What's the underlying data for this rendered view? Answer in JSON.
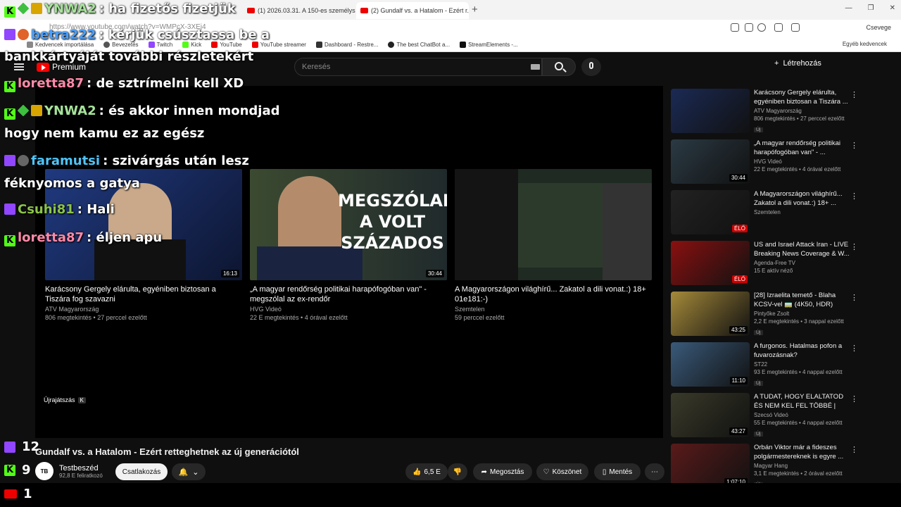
{
  "browser": {
    "tabs": [
      {
        "label": "(1) 2026.03.31. A 150-es személysz..."
      },
      {
        "label": "(2) Gundalf vs. a Hatalom - Ezért r..."
      }
    ],
    "url": "https://www.youtube.com/watch?v=WMPcX-3XEj4",
    "profile_label": "Csevege",
    "bookmarks": [
      "Kedvencek importálása",
      "Bevezetés",
      "Twitch",
      "Kick",
      "YouTube",
      "YouTube streamer",
      "Dashboard - Restre...",
      "The best ChatBot a...",
      "StreamElements -..."
    ],
    "bookmarks_right": "Egyéb kedvencek"
  },
  "youtube": {
    "logo_label": "Premium",
    "search_placeholder": "Keresés",
    "create_label": "Létrehozás",
    "end_cards": [
      {
        "title": "Karácsony Gergely elárulta, egyéniben biztosan a Tiszára fog szavazni",
        "channel": "ATV Magyarország",
        "meta": "806 megtekintés • 27 perccel ezelőtt",
        "duration": "16:13",
        "thumb_color": "#1b2a55"
      },
      {
        "title": "„A magyar rendőrség politikai harapófogóban van\" - megszólal az ex-rendőr",
        "channel": "HVG Videó",
        "meta": "22 E megtekintés • 4 órával ezelőtt",
        "duration": "30:44",
        "thumb_color": "#2b3a44",
        "overlay": "MEGSZÓLAL A VOLT SZÁZADOS"
      },
      {
        "title": "A Magyarországon világhírű... Zakatol a dili vonat.:) 18+ 01e181:-)",
        "channel": "Szemtelen",
        "meta": "59 perccel ezelőtt",
        "duration": "",
        "thumb_color": "#1e2a22"
      }
    ],
    "replay_label": "Újrajátszás",
    "replay_key": "K",
    "video_title": "Gundalf vs. a Hatalom - Ezért retteghetnek az új generációtól",
    "channel_name": "Testbeszéd",
    "channel_avatar": "TB",
    "subscribers": "92,8 E feliratkozó",
    "join_label": "Csatlakozás",
    "likes": "6,5 E",
    "share_label": "Megosztás",
    "thanks_label": "Köszönet",
    "save_label": "Mentés",
    "recommendations": [
      {
        "title": "Karácsony Gergely elárulta, egyéniben biztosan a Tiszára ...",
        "channel": "ATV Magyarország",
        "meta": "806 megtekintés • 27 perccel ezelőtt",
        "badge": "Új",
        "duration": "",
        "live": false,
        "color": "#1b2a55"
      },
      {
        "title": "„A magyar rendőrség politikai harapófogóban van\" - ...",
        "channel": "HVG Videó",
        "meta": "22 E megtekintés • 4 órával ezelőtt",
        "badge": "",
        "duration": "30:44",
        "live": false,
        "color": "#2b3a44"
      },
      {
        "title": "A Magyarországon világhírű... Zakatol a dili vonat.:) 18+ ...",
        "channel": "Szemtelen",
        "meta": "",
        "badge": "",
        "duration": "ÉLŐ",
        "live": true,
        "color": "#222"
      },
      {
        "title": "US and Israel Attack Iran - LIVE Breaking News Coverage & W...",
        "channel": "Agenda-Free TV",
        "meta": "15 E aktív néző",
        "badge": "",
        "duration": "ÉLŐ",
        "live": true,
        "color": "#8a1010"
      },
      {
        "title": "[28] Izraelita temető - Blaha KCSV-vel 🚃 (4K50, HDR)",
        "channel": "Pintyőke Zsolt",
        "meta": "2,2 E megtekintés • 3 nappal ezelőtt",
        "badge": "Új",
        "duration": "43:25",
        "live": false,
        "color": "#a58a3a"
      },
      {
        "title": "A furgonos. Hatalmas pofon a fuvarozásnak?",
        "channel": "ST22",
        "meta": "93 E megtekintés • 4 nappal ezelőtt",
        "badge": "Új",
        "duration": "11:10",
        "live": false,
        "color": "#3a5a7a"
      },
      {
        "title": "A TUDAT, HOGY ELALTATOD ÉS NEM KEL FEL TÖBBÉ | Szecsó ...",
        "channel": "Szecsó Videó",
        "meta": "55 E megtekintés • 4 nappal ezelőtt",
        "badge": "Új",
        "duration": "43:27",
        "live": false,
        "color": "#3a3a2a"
      },
      {
        "title": "Orbán Viktor már a fideszes polgármestereknek is egyre ...",
        "channel": "Magyar Hang",
        "meta": "3,1 E megtekintés • 2 órával ezelőtt",
        "badge": "Új",
        "duration": "1:07:10",
        "live": false,
        "color": "#5a1a1a"
      }
    ]
  },
  "chat": [
    {
      "user": "YNWA2",
      "text": ": ha fizetős fizetjük",
      "color": "#a6e39a",
      "badges": [
        "kick",
        "green",
        "gold"
      ]
    },
    {
      "user": "betra222",
      "text": ": kérjük csúsztassa be a",
      "color": "#4aa0ff",
      "badges": [
        "twitch",
        "orange"
      ]
    },
    {
      "user": "",
      "text": "bankkártyáját további részletekért",
      "color": "#ffffff",
      "badges": []
    },
    {
      "user": "loretta87",
      "text": ": de sztrímelni kell XD",
      "color": "#ff8aa8",
      "badges": [
        "kick"
      ]
    },
    {
      "user": "YNWA2",
      "text": ": és akkor innen mondjad",
      "color": "#a6e39a",
      "badges": [
        "kick",
        "green",
        "gold"
      ]
    },
    {
      "user": "",
      "text": "hogy nem kamu ez az egész",
      "color": "#ffffff",
      "badges": []
    },
    {
      "user": "faramutsi",
      "text": ": szivárgás után lesz",
      "color": "#4fc3f7",
      "badges": [
        "twitch",
        "gray"
      ]
    },
    {
      "user": "",
      "text": "féknyomos a gatya",
      "color": "#ffffff",
      "badges": []
    },
    {
      "user": "Csuhi81",
      "text": ": Hali",
      "color": "#8bc34a",
      "badges": [
        "twitch"
      ]
    },
    {
      "user": "loretta87",
      "text": ": éljen apu",
      "color": "#ff8aa8",
      "badges": [
        "kick"
      ]
    }
  ],
  "counters": {
    "twitch": "12",
    "kick": "9",
    "youtube": "1"
  },
  "colors": {
    "bg": "#0f0f0f",
    "accent_red": "#ff0000",
    "kick_green": "#53fc18",
    "twitch_purple": "#9146ff"
  }
}
